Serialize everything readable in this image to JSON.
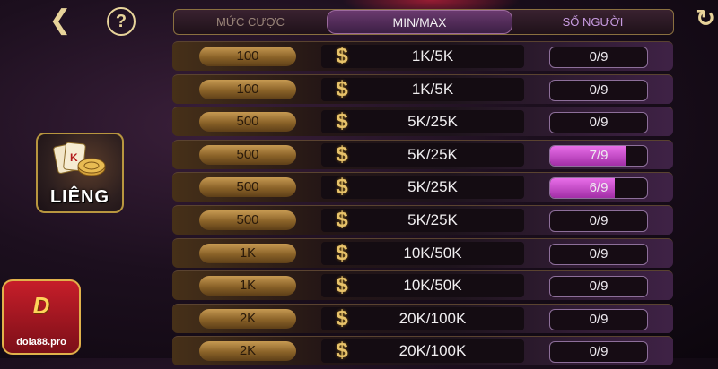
{
  "header": {
    "col_bet": "MỨC CƯỢC",
    "col_minmax": "MIN/MAX",
    "col_players": "SỐ NGƯỜI"
  },
  "icons": {
    "back": "chevron-left-icon",
    "help": "question-icon",
    "refresh": "refresh-icon",
    "currency": "dollar-icon"
  },
  "nav": {
    "back_glyph": "❮",
    "help_glyph": "?",
    "refresh_glyph": "↻"
  },
  "game": {
    "name": "LIÊNG"
  },
  "logo": {
    "letters": "D",
    "url": "dola88.pro"
  },
  "colors": {
    "accent_gold": "#e8c36a",
    "players_fill": "#d25ad6"
  },
  "rows": [
    {
      "bet": "100",
      "range": "1K/5K",
      "players": "0/9",
      "fill": 0
    },
    {
      "bet": "100",
      "range": "1K/5K",
      "players": "0/9",
      "fill": 0
    },
    {
      "bet": "500",
      "range": "5K/25K",
      "players": "0/9",
      "fill": 0
    },
    {
      "bet": "500",
      "range": "5K/25K",
      "players": "7/9",
      "fill": 0.778
    },
    {
      "bet": "500",
      "range": "5K/25K",
      "players": "6/9",
      "fill": 0.667
    },
    {
      "bet": "500",
      "range": "5K/25K",
      "players": "0/9",
      "fill": 0
    },
    {
      "bet": "1K",
      "range": "10K/50K",
      "players": "0/9",
      "fill": 0
    },
    {
      "bet": "1K",
      "range": "10K/50K",
      "players": "0/9",
      "fill": 0
    },
    {
      "bet": "2K",
      "range": "20K/100K",
      "players": "0/9",
      "fill": 0
    },
    {
      "bet": "2K",
      "range": "20K/100K",
      "players": "0/9",
      "fill": 0
    }
  ]
}
